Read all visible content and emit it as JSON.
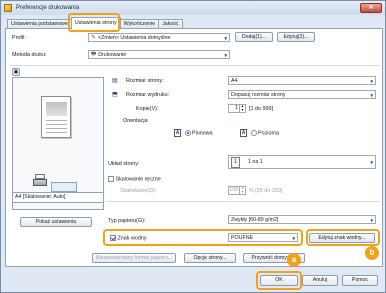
{
  "window": {
    "title": "Preferencje drukowania"
  },
  "tabs": [
    {
      "label": "Ustawienia podstawowe",
      "active": false
    },
    {
      "label": "Ustawienia strony",
      "active": true
    },
    {
      "label": "Wykończenie",
      "active": false
    },
    {
      "label": "Jakość",
      "active": false
    }
  ],
  "profile": {
    "label": "Profil:",
    "value": "<Zmień> Ustawienia domyślne",
    "add_button": "Dodaj(1)...",
    "edit_button": "Edytuj(2)..."
  },
  "print_method": {
    "label": "Metoda druku:",
    "value": "Drukowanie"
  },
  "preview": {
    "status": "A4 [Skalowanie: Auto]",
    "show_settings_button": "Pokaż ustawienia"
  },
  "page_size": {
    "label": "Rozmiar strony:",
    "value": "A4"
  },
  "output_size": {
    "label": "Rozmiar wydruku:",
    "value": "Dopasuj rozmiar strony"
  },
  "copies": {
    "label": "Kopie(V):",
    "value": "1",
    "range": "[1 do 999]"
  },
  "orientation": {
    "label": "Orientacja",
    "portrait": "Pionowa",
    "landscape": "Pozioma",
    "portrait_icon": "A",
    "landscape_icon": "A"
  },
  "page_layout": {
    "label": "Układ strony:",
    "value": "1 na 1",
    "icon_value": "1"
  },
  "manual_scaling": {
    "label": "Skalowanie ręczne",
    "scaling_label": "Skalowanie(D):",
    "value": "100",
    "range": "% [25 do 200]"
  },
  "paper_type": {
    "label": "Typ papieru(G):",
    "value": "Zwykły [60-89 g/m2]"
  },
  "watermark": {
    "label": "Znak wodny",
    "value": "POUFNE",
    "edit_button": "Edytuj znak wodny..."
  },
  "bottom_buttons": {
    "custom_paper": "Niestandardowy format papieru...",
    "page_options": "Opcje strony...",
    "restore_defaults": "Przywróć domyślne"
  },
  "dialog_buttons": {
    "ok": "OK",
    "cancel": "Anuluj",
    "help": "Pomoc"
  },
  "callouts": {
    "a": "a",
    "b": "b"
  },
  "colors": {
    "highlight": "#f2a21a",
    "panel_bg": "#ffffff",
    "window_bg": "#dfe8f3"
  }
}
